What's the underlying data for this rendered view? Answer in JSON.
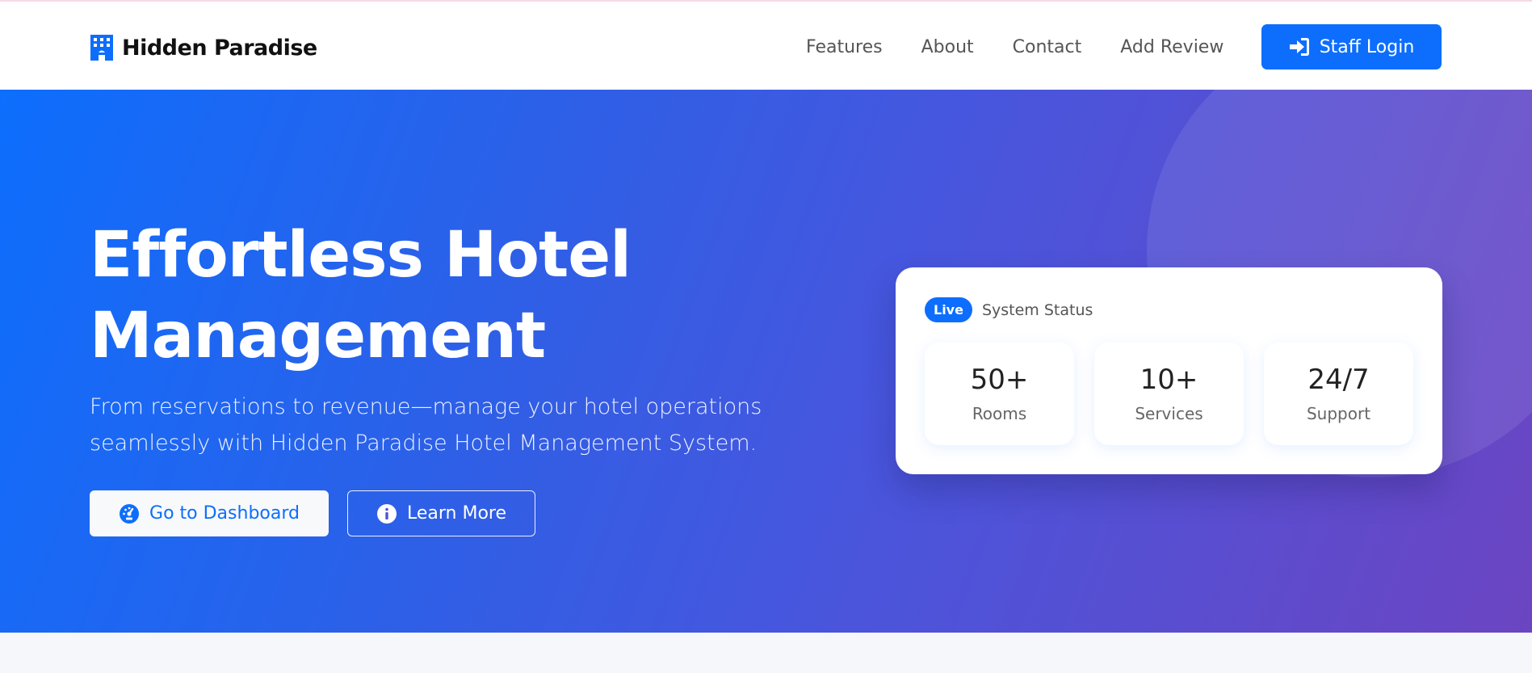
{
  "brand": {
    "name": "Hidden Paradise",
    "icon": "building-icon"
  },
  "nav": {
    "links": [
      "Features",
      "About",
      "Contact",
      "Add Review"
    ],
    "login_label": "Staff Login",
    "login_icon": "sign-in-icon"
  },
  "hero": {
    "title": "Effortless Hotel Management",
    "subtitle": "From reservations to revenue—manage your hotel operations seamlessly with Hidden Paradise Hotel Management System.",
    "primary_button": {
      "label": "Go to Dashboard",
      "icon": "speedometer-icon"
    },
    "secondary_button": {
      "label": "Learn More",
      "icon": "info-circle-icon"
    }
  },
  "status_card": {
    "badge": "Live",
    "label": "System Status",
    "stats": [
      {
        "value": "50+",
        "label": "Rooms"
      },
      {
        "value": "10+",
        "label": "Services"
      },
      {
        "value": "24/7",
        "label": "Support"
      }
    ]
  },
  "colors": {
    "primary": "#0d6efd",
    "gradient_start": "#0d6efd",
    "gradient_end": "#6b45c2"
  }
}
